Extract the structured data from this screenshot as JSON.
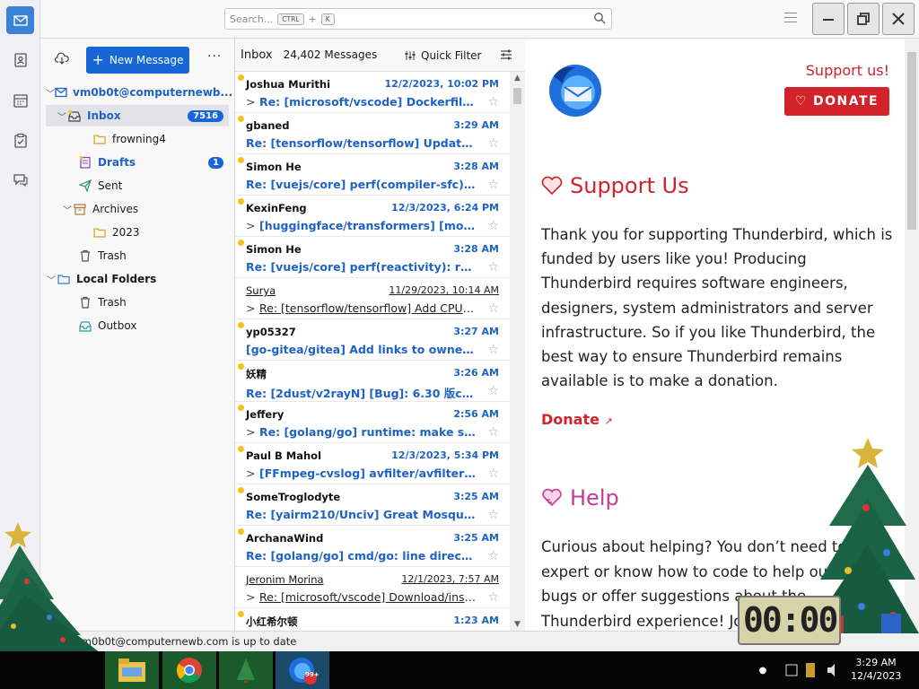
{
  "topbar": {
    "search_placeholder": "Search...",
    "search_key1": "CTRL",
    "search_plus": "+",
    "search_key2": "K"
  },
  "folders": {
    "new_message_label": "New Message",
    "more_label": "···",
    "account": "vm0b0t@computernewb...",
    "items": [
      {
        "label": "Inbox",
        "badge": "7516"
      },
      {
        "label": "frowning4"
      },
      {
        "label": "Drafts",
        "badge": "1"
      },
      {
        "label": "Sent"
      },
      {
        "label": "Archives"
      },
      {
        "label": "2023"
      },
      {
        "label": "Trash"
      },
      {
        "label": "Local Folders"
      },
      {
        "label": "Trash"
      },
      {
        "label": "Outbox"
      }
    ]
  },
  "list": {
    "title": "Inbox",
    "count": "24,402 Messages",
    "quick_filter": "Quick Filter",
    "messages": [
      {
        "sender": "Joshua Murithi",
        "date": "12/2/2023, 10:02 PM",
        "subject": "Re: [microsoft/vscode] Dockerfile CO...",
        "unread": true,
        "thread": true
      },
      {
        "sender": "gbaned",
        "date": "3:29 AM",
        "subject": "Re: [tensorflow/tensorflow] Update Sig...",
        "unread": true,
        "thread": false
      },
      {
        "sender": "Simon He",
        "date": "3:28 AM",
        "subject": "Re: [vuejs/core] perf(compiler-sfc): defi...",
        "unread": true,
        "thread": false
      },
      {
        "sender": "KexinFeng",
        "date": "12/3/2023, 6:24 PM",
        "subject": "[huggingface/transformers] [modelli...",
        "unread": true,
        "thread": true
      },
      {
        "sender": "Simon He",
        "date": "3:28 AM",
        "subject": "Re: [vuejs/core] perf(reactivity): refacto...",
        "unread": true,
        "thread": false
      },
      {
        "sender": "Surya",
        "date": "11/29/2023, 10:14 AM",
        "subject": "Re: [tensorflow/tensorflow] Add CPU ke...",
        "unread": false,
        "thread": true
      },
      {
        "sender": "yp05327",
        "date": "3:27 AM",
        "subject": "[go-gitea/gitea] Add links to owner ho...",
        "unread": true,
        "thread": false
      },
      {
        "sender": "妖精",
        "date": "3:26 AM",
        "subject": "Re: [2dust/v2rayN] [Bug]: 6.30 版core类...",
        "unread": true,
        "thread": false
      },
      {
        "sender": "Jeffery",
        "date": "2:56 AM",
        "subject": "Re: [golang/go] runtime: make scan ...",
        "unread": true,
        "thread": true
      },
      {
        "sender": "Paul B Mahol",
        "date": "12/3/2023, 5:34 PM",
        "subject": "[FFmpeg-cvslog] avfilter/avfilter: fix ...",
        "unread": true,
        "thread": true
      },
      {
        "sender": "SomeTroglodyte",
        "date": "3:25 AM",
        "subject": "Re: [yairm210/Unciv] Great Mosque of ...",
        "unread": true,
        "thread": false
      },
      {
        "sender": "ArchanaWind",
        "date": "3:25 AM",
        "subject": "Re: [golang/go] cmd/go: line directives...",
        "unread": true,
        "thread": false
      },
      {
        "sender": "Jeronim Morina",
        "date": "12/1/2023, 7:57 AM",
        "subject": "Re: [microsoft/vscode] Download/install...",
        "unread": false,
        "thread": true
      },
      {
        "sender": "小红希尔顿",
        "date": "1:23 AM",
        "subject": "",
        "unread": true,
        "thread": false
      }
    ]
  },
  "content": {
    "support_link": "Support us!",
    "donate_button": "DONATE",
    "heading_support": "Support Us",
    "paragraph1": "Thank you for supporting Thunderbird, which is funded by users like you! Producing Thunderbird requires software engineers, designers, system administrators and server infrastructure. So if you like Thunderbird, the best way to ensure Thunderbird remains available is to make a donation.",
    "donate_link": "Donate",
    "heading_help": "Help",
    "paragraph2": "Curious about helping? You don’t need to be an expert or know how to code to help out. Report bugs or offer suggestions about the Thunderbird experience! Join us in this community."
  },
  "status": {
    "text": "vm0b0t@computernewb.com is up to date"
  },
  "desktop_clock": {
    "text": "00:00"
  },
  "taskbar": {
    "time": "3:29 AM",
    "date": "12/4/2023",
    "thunderbird_badge": "99+"
  },
  "colors": {
    "accent": "#1766d6",
    "donate_red": "#d2232a",
    "help_pink": "#c43a94",
    "unread_blue": "#1e62c4"
  }
}
